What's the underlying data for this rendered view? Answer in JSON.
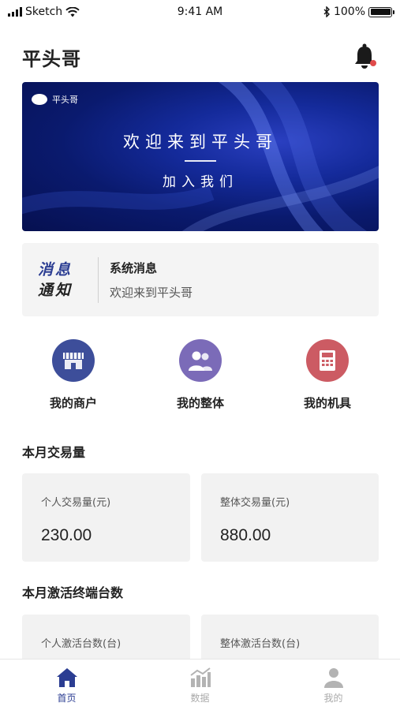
{
  "status_bar": {
    "carrier": "Sketch",
    "time": "9:41 AM",
    "battery": "100%"
  },
  "header": {
    "title": "平头哥"
  },
  "banner": {
    "logo_text": "平头哥",
    "title": "欢迎来到平头哥",
    "subtitle": "加入我们"
  },
  "notice": {
    "tag_line1": "消息",
    "tag_line2": "通知",
    "title": "系统消息",
    "text": "欢迎来到平头哥"
  },
  "menu": [
    {
      "label": "我的商户",
      "icon": "storefront-icon",
      "color": "#3d4e9a"
    },
    {
      "label": "我的整体",
      "icon": "group-icon",
      "color": "#7b6bb8"
    },
    {
      "label": "我的机具",
      "icon": "pos-terminal-icon",
      "color": "#cc5b63"
    }
  ],
  "monthly_volume": {
    "title": "本月交易量",
    "personal_label": "个人交易量(元)",
    "personal_value": "230.00",
    "overall_label": "整体交易量(元)",
    "overall_value": "880.00"
  },
  "activation": {
    "title": "本月激活终端台数",
    "personal_label": "个人激活台数(台)",
    "overall_label": "整体激活台数(台)"
  },
  "tabs": [
    {
      "label": "首页",
      "icon": "home-icon",
      "active": true
    },
    {
      "label": "数据",
      "icon": "chart-icon",
      "active": false
    },
    {
      "label": "我的",
      "icon": "user-icon",
      "active": false
    }
  ],
  "colors": {
    "primary": "#2b3d92",
    "banner": "#0a1a6e",
    "notification_dot": "#e04b4b",
    "tab_inactive": "#aaaaaa"
  }
}
